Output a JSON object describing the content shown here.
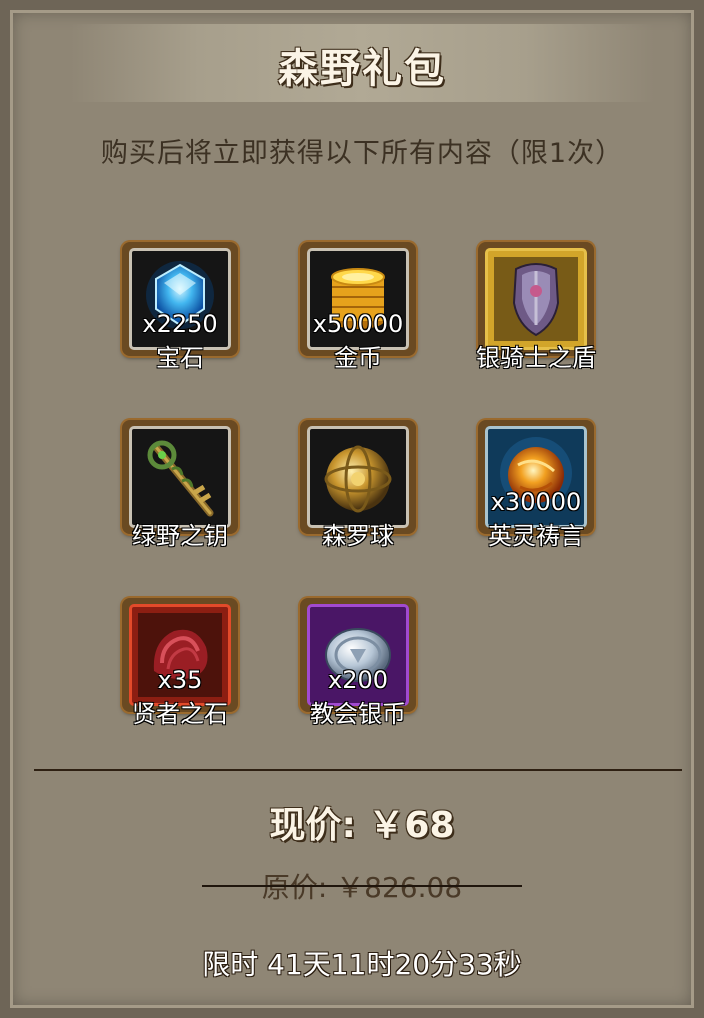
{
  "title": "森野礼包",
  "subtitle": "购买后将立即获得以下所有内容（限1次）",
  "items": [
    {
      "name": "宝石",
      "qty": "x2250",
      "icon": "gem-icon"
    },
    {
      "name": "金币",
      "qty": "x50000",
      "icon": "gold-coins-icon"
    },
    {
      "name": "银骑士之盾",
      "qty": "",
      "icon": "shield-icon"
    },
    {
      "name": "绿野之钥",
      "qty": "",
      "icon": "key-icon"
    },
    {
      "name": "森罗球",
      "qty": "",
      "icon": "golden-orb-icon"
    },
    {
      "name": "英灵祷言",
      "qty": "x30000",
      "icon": "fire-orb-icon"
    },
    {
      "name": "贤者之石",
      "qty": "x35",
      "icon": "red-stone-icon"
    },
    {
      "name": "教会银币",
      "qty": "x200",
      "icon": "silver-coin-icon"
    }
  ],
  "price": {
    "current": "现价: ￥68",
    "original": "原价: ￥826.08"
  },
  "timer": "限时 41天11时20分33秒"
}
